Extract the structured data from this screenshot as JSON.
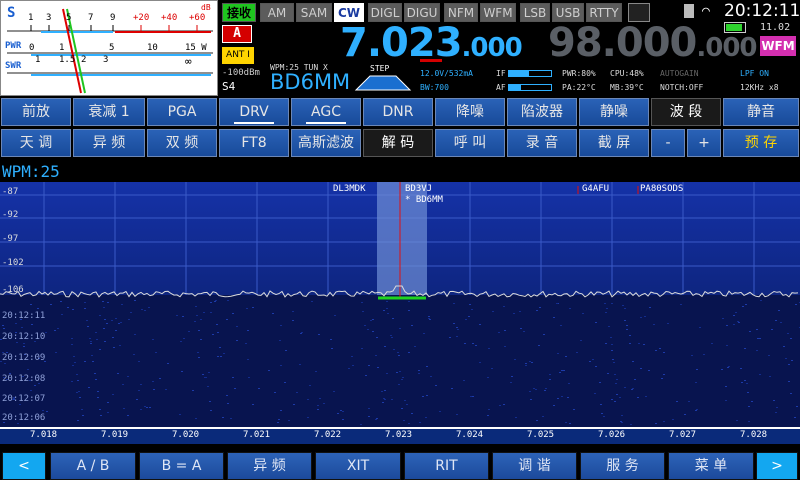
{
  "meter": {
    "s_label": "S",
    "db_label": "dB",
    "s_scale": [
      "1",
      "3",
      "5",
      "7",
      "9",
      "+20",
      "+40",
      "+60"
    ],
    "pwr_label": "PWR",
    "pwr_scale": [
      "0",
      "1",
      "5",
      "10",
      "15 W"
    ],
    "swr_label": "SWR",
    "swr_scale": [
      "1",
      "1.5",
      "2",
      "3",
      "∞"
    ],
    "dbm": "-100dBm",
    "s_reading": "S4"
  },
  "modes": {
    "rx": "接收",
    "items": [
      "AM",
      "SAM",
      "CW",
      "DIGL",
      "DIGU",
      "NFM",
      "WFM",
      "LSB",
      "USB",
      "RTTY"
    ],
    "active": "CW"
  },
  "status": {
    "time": "20:12:11",
    "date": "11.02",
    "band_mode": "WFM",
    "antenna_vfo": "A",
    "ant": "ANT I",
    "wpm_tun": "WPM:25 TUN X",
    "callsign": "BD6MM",
    "step": "STEP",
    "voltage": "12.0V/532mA",
    "bw": "BW:700",
    "if_label": "IF",
    "af_label": "AF",
    "pwr": "PWR:80%",
    "cpu": "CPU:48%",
    "pa": "PA:22°C",
    "mb": "MB:39°C",
    "autogain": "AUTOGAIN",
    "notch": "NOTCH:OFF",
    "lpf": "LPF ON",
    "khz": "12KHz x8"
  },
  "freq": {
    "vfo_a_main": "7.023",
    "vfo_a_sub": ".000",
    "vfo_b_main": "98.000",
    "vfo_b_sub": ".000"
  },
  "row1": [
    "前放",
    "衰减 1",
    "PGA",
    "DRV",
    "AGC",
    "DNR",
    "降噪",
    "陷波器",
    "静噪",
    "波 段",
    "静音"
  ],
  "row2": [
    "天 调",
    "异 频",
    "双 频",
    "FT8",
    "高斯滤波",
    "解 码",
    "呼 叫",
    "录 音",
    "截 屏",
    "-",
    "+",
    "预 存"
  ],
  "decoder": "WPM:25",
  "spectrum": {
    "db_labels": [
      "-87",
      "-92",
      "-97",
      "-102",
      "-106"
    ],
    "calls": [
      "DL3MDK",
      "BD3VJ",
      "* BD6MM",
      "G4AFU",
      "PA80SODS"
    ],
    "times": [
      "20:12:11",
      "20:12:10",
      "20:12:09",
      "20:12:08",
      "20:12:07",
      "20:12:06"
    ],
    "freq_ticks": [
      "7.018",
      "7.019",
      "7.020",
      "7.021",
      "7.022",
      "7.023",
      "7.024",
      "7.025",
      "7.026",
      "7.027",
      "7.028"
    ]
  },
  "bottom": [
    "<",
    "A / B",
    "B = A",
    "异 频",
    "XIT",
    "RIT",
    "调 谐",
    "服 务",
    "菜 单",
    ">"
  ],
  "colors": {
    "accent_blue": "#2fb0ff",
    "button_blue": "#2a62b7",
    "rx_green": "#1fc51f",
    "wfm_magenta": "#d42fb0",
    "vfo_red": "#d40000"
  }
}
